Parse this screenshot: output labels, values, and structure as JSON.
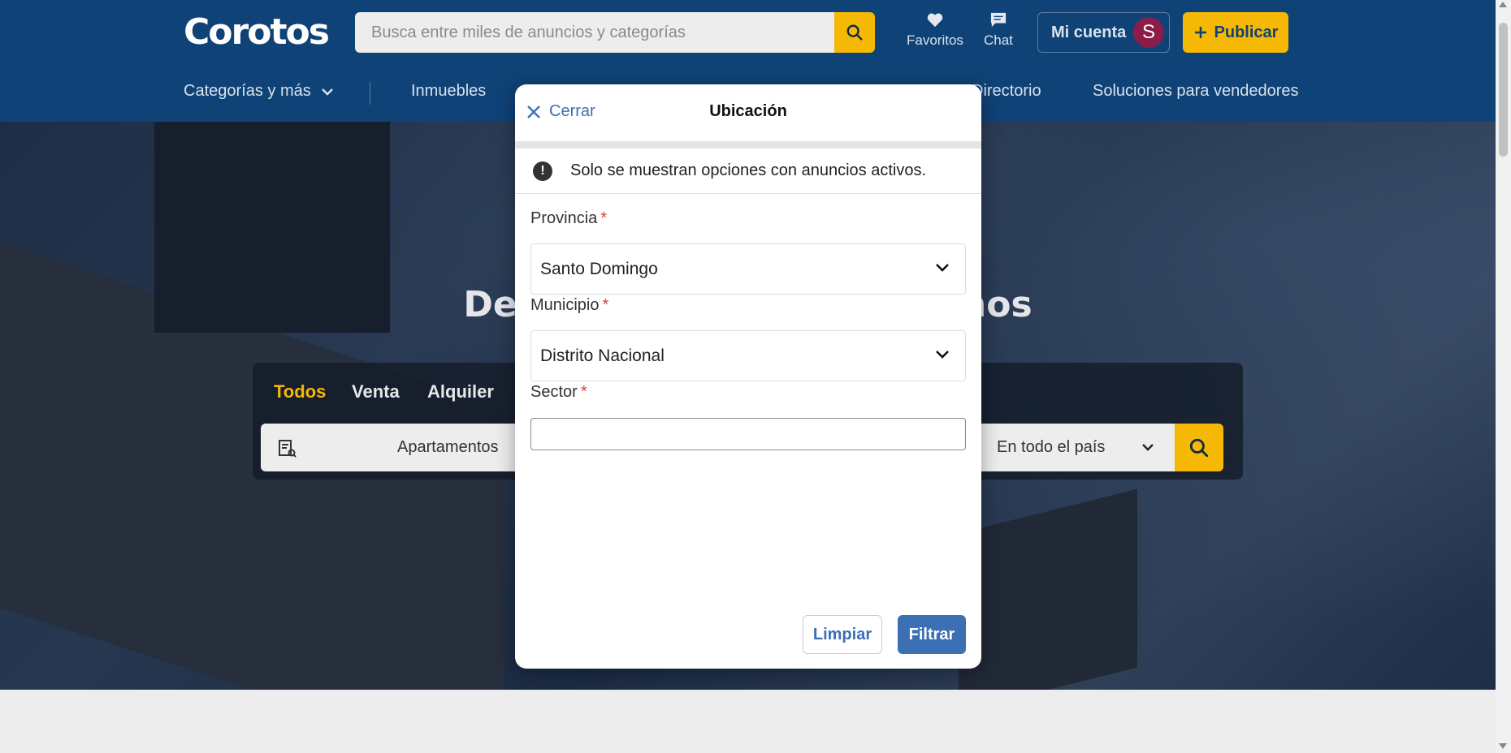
{
  "header": {
    "logo": "Corotos",
    "search_placeholder": "Busca entre miles de anuncios y categorías",
    "favorites_label": "Favoritos",
    "chat_label": "Chat",
    "account_label": "Mi cuenta",
    "avatar_initial": "S",
    "publish_label": "Publicar"
  },
  "nav": {
    "categories": "Categorías y más",
    "items": [
      "Inmuebles",
      "Directorio",
      "Soluciones para vendedores"
    ]
  },
  "hero": {
    "title_left": "Des",
    "title_right": "ños",
    "tabs": [
      "Todos",
      "Venta",
      "Alquiler"
    ],
    "category_value": "Apartamentos",
    "location_value": "En todo el país"
  },
  "modal": {
    "close_label": "Cerrar",
    "title": "Ubicación",
    "notice": "Solo se muestran opciones con anuncios activos.",
    "province_label": "Provincia",
    "province_value": "Santo Domingo",
    "municipality_label": "Municipio",
    "municipality_value": "Distrito Nacional",
    "sector_label": "Sector",
    "sector_value": "",
    "required_mark": "*",
    "clear_label": "Limpiar",
    "filter_label": "Filtrar"
  },
  "colors": {
    "header_bg": "#0f4276",
    "accent_yellow": "#f5b804",
    "link_blue": "#3d6fb5",
    "required_red": "#e53935"
  },
  "icons": [
    "search-icon",
    "heart-icon",
    "chat-bubble-icon",
    "plus-icon",
    "chevron-down-icon",
    "close-icon",
    "exclamation-icon",
    "building-list-icon"
  ]
}
